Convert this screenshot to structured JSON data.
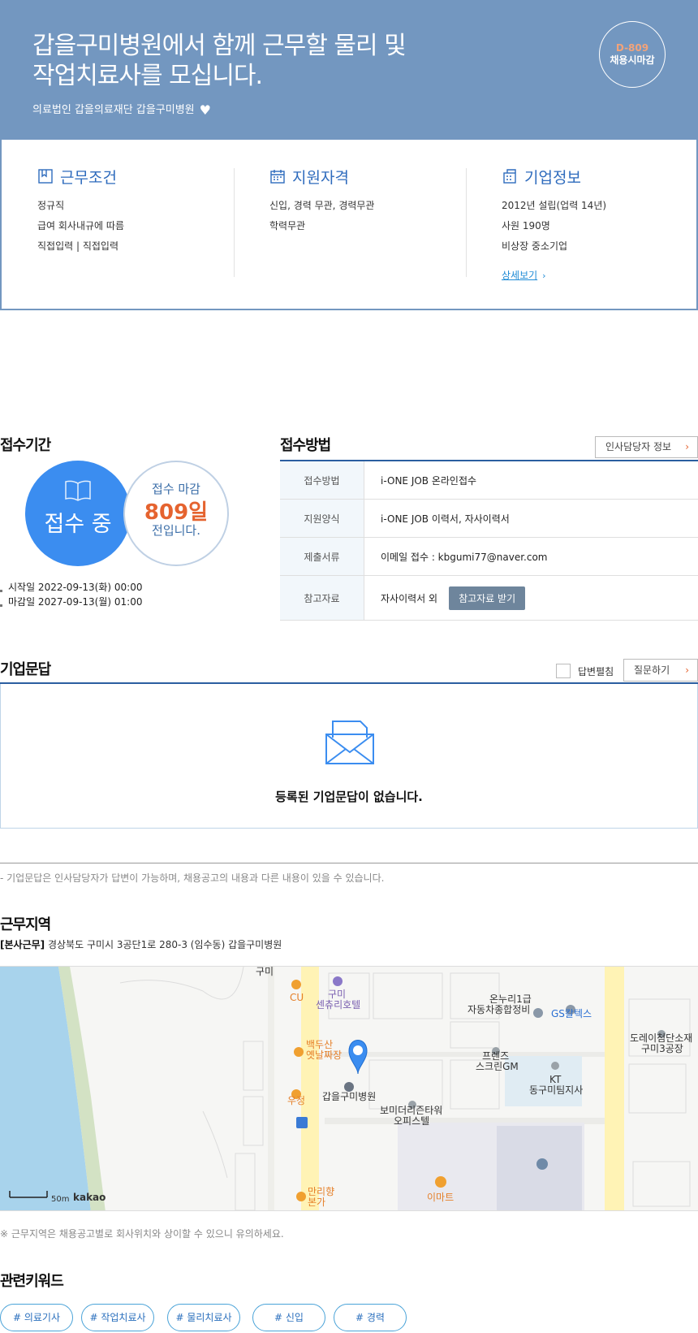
{
  "hero": {
    "title_line1": "갑을구미병원에서 함께 근무할 물리 및",
    "title_line2": "작업치료사를 모십니다.",
    "company": "의료법인 갑을의료재단 갑을구미병원",
    "dday_code": "D-809",
    "dday_text": "채용시마감"
  },
  "info": {
    "work": {
      "title": "근무조건",
      "items": [
        "정규직",
        "급여 회사내규에 따름",
        "직접입력 | 직접입력"
      ]
    },
    "qual": {
      "title": "지원자격",
      "items": [
        "신입, 경력 무관, 경력무관",
        "학력무관"
      ]
    },
    "company": {
      "title": "기업정보",
      "items": [
        "2012년 설립(업력 14년)",
        "사원 190명",
        "비상장 중소기업"
      ],
      "detail_link": "상세보기"
    }
  },
  "period": {
    "title": "접수기간",
    "status": "접수 중",
    "deadline_prefix": "접수 마감",
    "deadline_days": "809일",
    "deadline_suffix": "전입니다.",
    "start": "시작일 2022-09-13(화) 00:00",
    "end": "마감일 2027-09-13(월) 01:00"
  },
  "method": {
    "title": "접수방법",
    "hr_button": "인사담당자 정보",
    "rows": [
      {
        "label": "접수방법",
        "value": "i-ONE JOB 온라인접수"
      },
      {
        "label": "지원양식",
        "value": "i-ONE JOB 이력서, 자사이력서"
      },
      {
        "label": "제출서류",
        "value": "이메일 접수 : kbgumi77@naver.com"
      },
      {
        "label": "참고자료",
        "value": "자사이력서 외",
        "button": "참고자료 받기"
      }
    ]
  },
  "qa": {
    "title": "기업문답",
    "toggle_label": "답변펼침",
    "ask_button": "질문하기",
    "empty": "등록된 기업문답이 없습니다.",
    "note": "- 기업문답은 인사담당자가 답변이 가능하며, 채용공고의 내용과 다른 내용이 있을 수 있습니다."
  },
  "location": {
    "title": "근무지역",
    "tag": "[본사근무]",
    "address": "경상북도 구미시 3공단1로 280-3 (임수동) 갑을구미병원",
    "note": "※ 근무지역은 채용공고별로 회사위치와 상이할 수 있으니 유의하세요.",
    "map": {
      "labels": [
        "구미",
        "CU",
        "구미",
        "센츄리호텔",
        "온누리1급",
        "자동차종합정비",
        "GS칼텍스",
        "도레이첨단소재",
        "구미3공장",
        "백두산",
        "옛날짜장",
        "프렌즈",
        "스크린GM",
        "KT",
        "동구미팀지사",
        "우정",
        "갑을구미병원",
        "보미더리즌타워",
        "오피스텔",
        "만리향",
        "본가",
        "이마트"
      ],
      "scale": "50m",
      "brand": "kakao"
    }
  },
  "keywords": {
    "title": "관련키워드",
    "items": [
      "# 의료기사",
      "# 작업치료사",
      "# 물리치료사",
      "# 신입",
      "# 경력"
    ]
  }
}
